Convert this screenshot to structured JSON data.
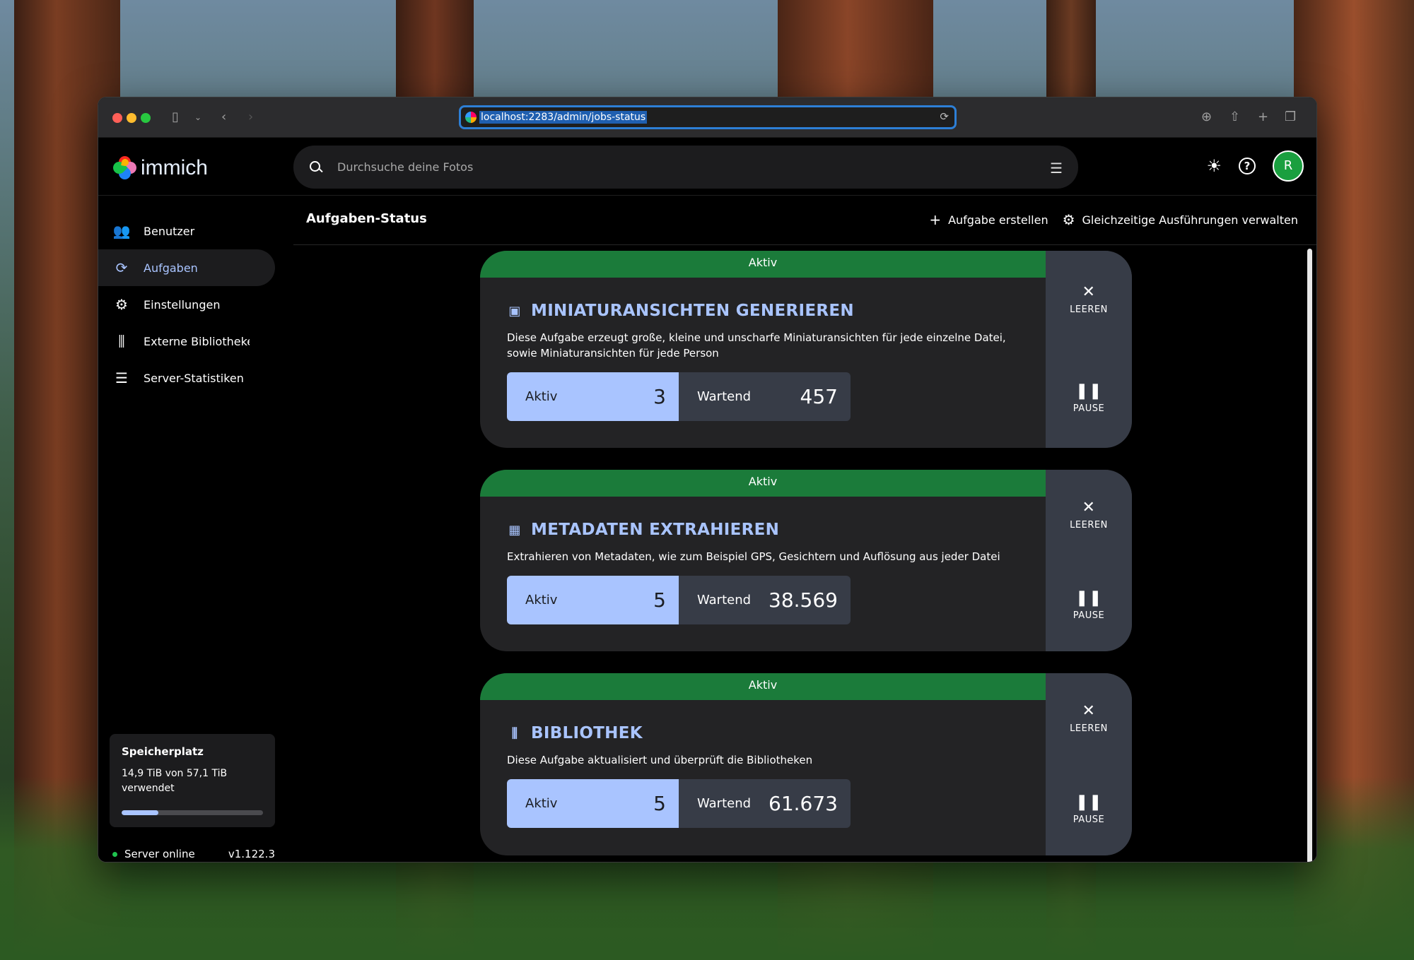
{
  "browser": {
    "url": "localhost:2283/admin/jobs-status"
  },
  "app": {
    "logo_text": "immich",
    "search_placeholder": "Durchsuche deine Fotos",
    "avatar_initial": "R"
  },
  "sidebar": {
    "items": [
      {
        "label": "Benutzer",
        "icon": "users-icon"
      },
      {
        "label": "Aufgaben",
        "icon": "sync-icon",
        "active": true
      },
      {
        "label": "Einstellungen",
        "icon": "gear-icon"
      },
      {
        "label": "Externe Bibliotheken",
        "icon": "library-icon"
      },
      {
        "label": "Server-Statistiken",
        "icon": "server-icon"
      }
    ],
    "storage": {
      "title": "Speicherplatz",
      "text": "14,9 TiB von 57,1 TiB verwendet",
      "used_fraction": 0.26
    },
    "server_status": "Server online",
    "version": "v1.122.3"
  },
  "main": {
    "title": "Aufgaben-Status",
    "actions": {
      "create": "Aufgabe erstellen",
      "concurrency": "Gleichzeitige Ausführungen verwalten"
    }
  },
  "jobs": [
    {
      "status": "Aktiv",
      "title": "MINIATURANSICHTEN GENERIEREN",
      "icon": "jpg-file-icon",
      "description": "Diese Aufgabe erzeugt große, kleine und unscharfe Miniaturansichten für jede einzelne Datei, sowie Miniaturansichten für jede Person",
      "active_label": "Aktiv",
      "active_count": "3",
      "waiting_label": "Wartend",
      "waiting_count": "457",
      "clear_label": "LEEREN",
      "pause_label": "PAUSE"
    },
    {
      "status": "Aktiv",
      "title": "METADATEN EXTRAHIEREN",
      "icon": "table-icon",
      "description": "Extrahieren von Metadaten, wie zum Beispiel GPS, Gesichtern und Auflösung aus jeder Datei",
      "active_label": "Aktiv",
      "active_count": "5",
      "waiting_label": "Wartend",
      "waiting_count": "38.569",
      "clear_label": "LEEREN",
      "pause_label": "PAUSE"
    },
    {
      "status": "Aktiv",
      "title": "BIBLIOTHEK",
      "icon": "library-icon",
      "description": "Diese Aufgabe aktualisiert und überprüft die Bibliotheken",
      "active_label": "Aktiv",
      "active_count": "5",
      "waiting_label": "Wartend",
      "waiting_count": "61.673",
      "clear_label": "LEEREN",
      "pause_label": "PAUSE"
    }
  ],
  "colors": {
    "accent": "#a9c4ff",
    "status_active": "#1b7b3a",
    "online": "#1fc24e"
  }
}
